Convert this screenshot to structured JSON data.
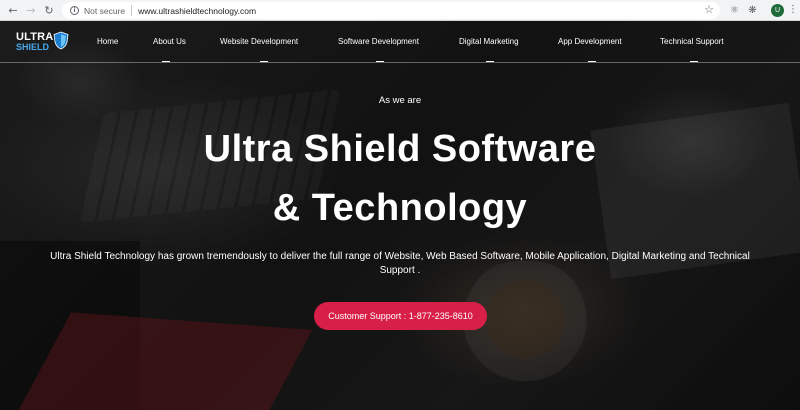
{
  "browser": {
    "security_label": "Not secure",
    "url": "www.ultrashieldtechnology.com",
    "profile_initial": "U"
  },
  "logo": {
    "line1": "ULTRA",
    "line2": "SHIELD"
  },
  "nav": {
    "items": [
      {
        "label": "Home"
      },
      {
        "label": "About Us"
      },
      {
        "label": "Website Development"
      },
      {
        "label": "Software Development"
      },
      {
        "label": "Digital Marketing"
      },
      {
        "label": "App Development"
      },
      {
        "label": "Technical Support"
      }
    ]
  },
  "hero": {
    "eyebrow": "As we are",
    "title_line1": "Ultra Shield Software",
    "title_line2": "& Technology",
    "description": "Ultra Shield Technology has grown tremendously to deliver the full range of Website, Web Based Software, Mobile Application, Digital Marketing and Technical Support .",
    "cta_label": "Customer Support : 1-877-235-8610"
  },
  "colors": {
    "cta_bg": "#d81f47",
    "logo_blue": "#4aa8e8",
    "text": "#ffffff"
  }
}
